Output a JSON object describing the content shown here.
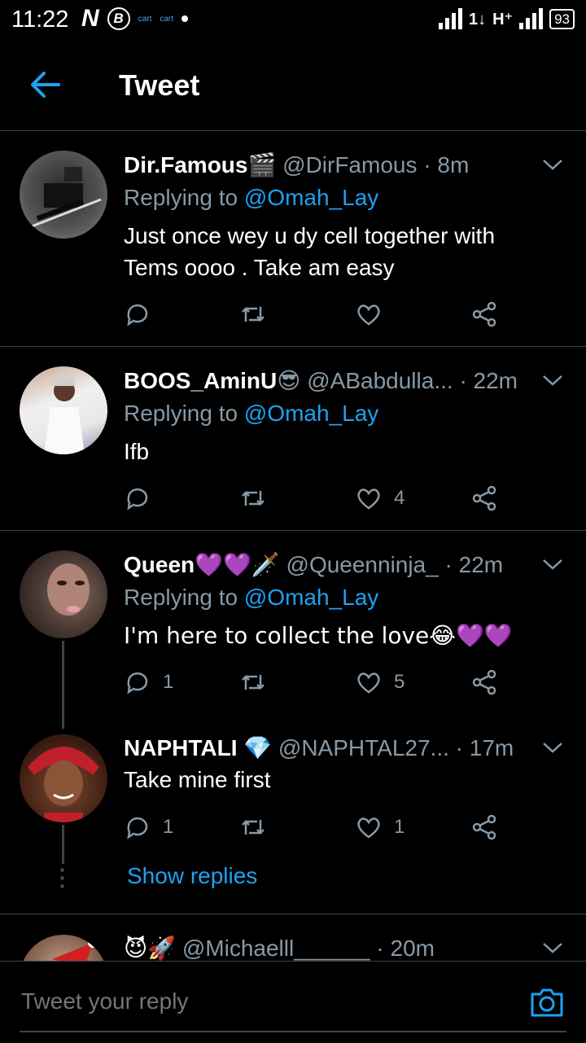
{
  "status_bar": {
    "time": "11:22",
    "n_icon": "N",
    "b_icon": "B",
    "carrier_1": "cart",
    "carrier_2": "cart",
    "data_type": "1↓",
    "network_type": "H⁺",
    "battery": "93"
  },
  "header": {
    "title": "Tweet",
    "back_icon": "arrow-left-icon"
  },
  "tweets": [
    {
      "name": "Dir.Famous",
      "name_emoji": "🎬",
      "handle": "@DirFamous",
      "time": "· 8m",
      "replying_prefix": "Replying to",
      "replying_to": "@Omah_Lay",
      "text": "Just once wey u dy cell together with Tems oooo . Take am easy",
      "reply_count": "",
      "like_count": ""
    },
    {
      "name": "BOOS_AminU",
      "name_emoji": "😎",
      "handle": "@ABabdulla...",
      "time": "· 22m",
      "replying_prefix": "Replying to",
      "replying_to": "@Omah_Lay",
      "text": "Ifb",
      "reply_count": "",
      "like_count": "4"
    },
    {
      "name": "Queen",
      "name_emoji": "💜💜🗡️",
      "handle": "@Queenninja_",
      "time": "· 22m",
      "replying_prefix": "Replying to",
      "replying_to": "@Omah_Lay",
      "text": "I'm  here to collect the love😂💜💜",
      "reply_count": "1",
      "like_count": "5"
    },
    {
      "name": "NAPHTALI",
      "name_emoji": "💎",
      "handle": "@NAPHTAL27...",
      "time": "· 17m",
      "text": "Take mine first",
      "reply_count": "1",
      "like_count": "1"
    },
    {
      "name": "😈🚀",
      "handle": "@Michaelll______",
      "time": "· 20m"
    }
  ],
  "show_replies": "Show replies",
  "composer": {
    "placeholder": "Tweet your reply",
    "camera_icon": "camera-icon"
  },
  "colors": {
    "accent": "#1da1f2",
    "muted": "#8899a6",
    "divider": "#38444d",
    "background": "#000000"
  }
}
